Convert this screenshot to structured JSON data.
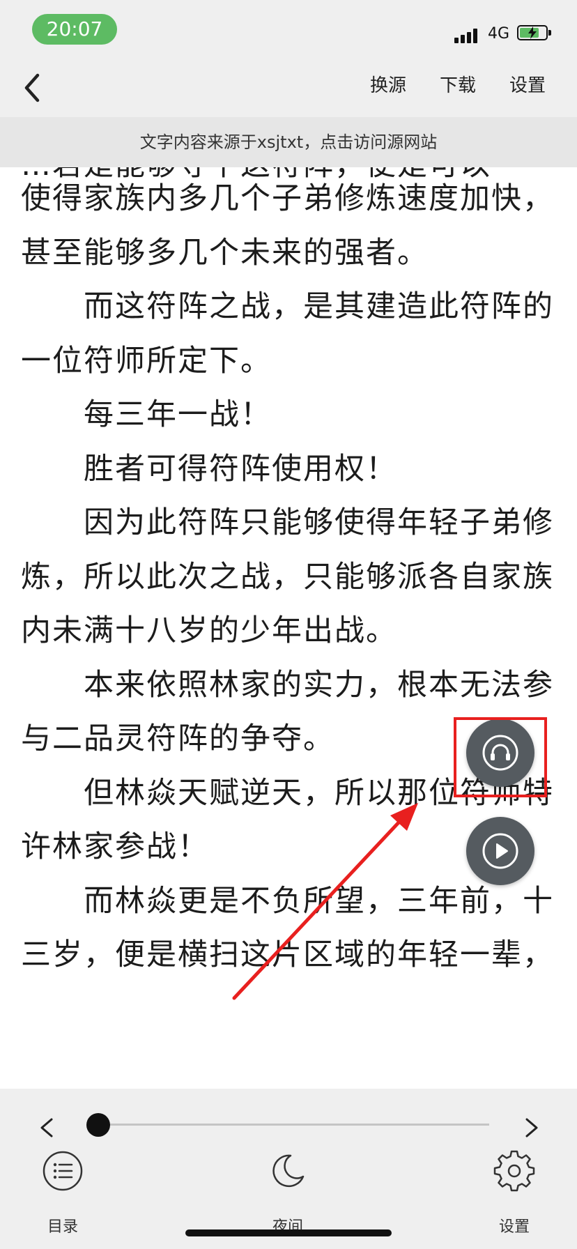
{
  "status_bar": {
    "time": "20:07",
    "network": "4G",
    "battery_level": 0.75
  },
  "nav": {
    "actions": [
      "换源",
      "下载",
      "设置"
    ]
  },
  "source_notice": "文字内容来源于xsjtxt，点击访问源网站",
  "content": {
    "partial_top_line": "…若是能够夺下这符阵，便是可以",
    "lines": [
      {
        "text": "使得家族内多几个子弟修炼速度加快，",
        "indent": false
      },
      {
        "text": "甚至能够多几个未来的强者。",
        "indent": false
      },
      {
        "text": "而这符阵之战，是其建造此符阵的",
        "indent": true
      },
      {
        "text": "一位符师所定下。",
        "indent": false
      },
      {
        "text": "每三年一战！",
        "indent": true
      },
      {
        "text": "胜者可得符阵使用权！",
        "indent": true
      },
      {
        "text": "因为此符阵只能够使得年轻子弟修",
        "indent": true
      },
      {
        "text": "炼，所以此次之战，只能够派各自家族",
        "indent": false
      },
      {
        "text": "内未满十八岁的少年出战。",
        "indent": false
      },
      {
        "text": "本来依照林家的实力，根本无法参",
        "indent": true
      },
      {
        "text": "与二品灵符阵的争夺。",
        "indent": false
      },
      {
        "text": "但林焱天赋逆天，所以那位符师特",
        "indent": true
      },
      {
        "text": "许林家参战！",
        "indent": false
      },
      {
        "text": "而林焱更是不负所望，三年前，十",
        "indent": true
      },
      {
        "text": "三岁，便是横扫这片区域的年轻一辈，",
        "indent": false
      }
    ]
  },
  "floating": {
    "listen_icon": "headphones-icon",
    "play_icon": "play-icon"
  },
  "annotation": {
    "color": "#e8201f"
  },
  "reader_progress": 0.0,
  "toolbar": {
    "catalog": "目录",
    "night": "夜间",
    "settings": "设置"
  },
  "colors": {
    "status_pill": "#5dbb63",
    "chrome_bg": "#efefef",
    "float_bg": "#555b60"
  }
}
